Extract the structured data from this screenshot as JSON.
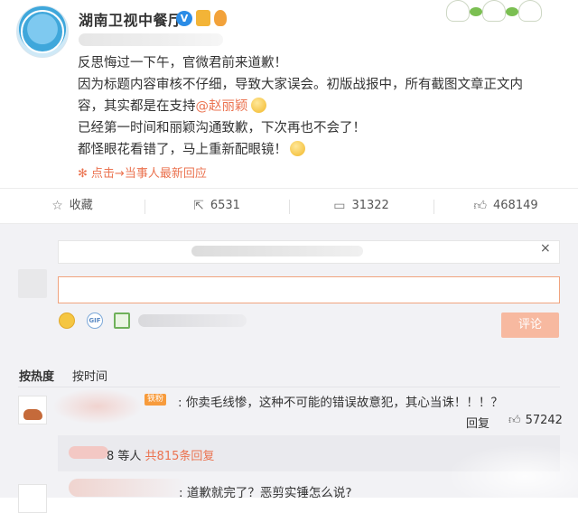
{
  "post": {
    "username": "湖南卫视中餐厅",
    "verified_badge": "V",
    "lines": [
      "反思悔过一下午，官微君前来道歉！",
      "因为标题内容审核不仔细，导致大家误会。初版战报中，所有截图文章正文内",
      "容，其实都是在支持",
      "已经第一时间和丽颖沟通致歉，下次再也不会了！",
      "都怪眼花看错了，马上重新配眼镜！"
    ],
    "mention": "@赵丽颖",
    "fold_link": "点击",
    "fold_link_rest": "当事人最新回应",
    "fold_icon": "flower-icon"
  },
  "actions": {
    "favorite": {
      "label": "收藏",
      "icon": "star-icon"
    },
    "forward": {
      "count": "6531",
      "icon": "share-icon"
    },
    "comment": {
      "count": "31322",
      "icon": "comment-icon"
    },
    "like": {
      "count": "468149",
      "icon": "thumbs-up-icon"
    }
  },
  "comment_box": {
    "close": "×",
    "gif": "GIF",
    "submit": "评论"
  },
  "sort": {
    "hot": "按热度",
    "time": "按时间"
  },
  "comments": [
    {
      "badge": "铁粉",
      "text": ": 你卖毛线惨，这种不可能的错误故意犯，其心当诛！！！？",
      "reply": "回复",
      "likes": "57242",
      "replies_prefix": "8 等人",
      "replies_count": "共815条回复"
    },
    {
      "text": ": 道歉就完了？恶剪实锤怎么说?"
    }
  ],
  "colors": {
    "accent": "#eb7350",
    "link_blue": "#2b8ce6",
    "panel_bg": "#f2f2f5"
  }
}
